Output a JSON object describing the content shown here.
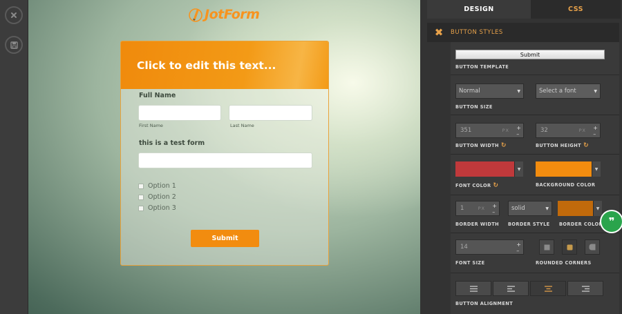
{
  "canvas": {
    "logo_text": "JotForm",
    "form": {
      "header_text": "Click to edit this text...",
      "full_name_label": "Full Name",
      "first_name_sublabel": "First Name",
      "last_name_sublabel": "Last Name",
      "test_field_label": "this is a test form",
      "options": [
        "Option 1",
        "Option 2",
        "Option 3"
      ],
      "submit_label": "Submit"
    }
  },
  "panel": {
    "tabs": [
      "DESIGN",
      "CSS"
    ],
    "active_tab": "DESIGN",
    "section_title": "BUTTON STYLES",
    "button_template": {
      "preview_label": "Submit",
      "caption": "BUTTON TEMPLATE"
    },
    "button_size": {
      "value": "Normal",
      "caption": "BUTTON SIZE",
      "font_placeholder": "Select a font"
    },
    "button_width": {
      "value": "351",
      "unit": "PX",
      "caption": "BUTTON WIDTH"
    },
    "button_height": {
      "value": "32",
      "unit": "PX",
      "caption": "BUTTON HEIGHT"
    },
    "font_color": {
      "caption": "FONT COLOR",
      "color": "#c0393b"
    },
    "background_color": {
      "caption": "BACKGROUND COLOR",
      "color": "#f28c0f"
    },
    "border_width": {
      "value": "1",
      "unit": "PX",
      "caption": "BORDER WIDTH"
    },
    "border_style": {
      "value": "solid",
      "caption": "BORDER STYLE"
    },
    "border_color": {
      "caption": "BORDER COLOR",
      "color": "#c16a0b"
    },
    "font_size": {
      "value": "14",
      "caption": "FONT SIZE"
    },
    "rounded_corners": {
      "caption": "ROUNDED CORNERS"
    },
    "button_alignment": {
      "caption": "BUTTON ALIGNMENT",
      "active": "center"
    }
  },
  "colors": {
    "accent": "#e8a24a",
    "brand_orange": "#f7931e",
    "feedback_green": "#2aa44c"
  }
}
